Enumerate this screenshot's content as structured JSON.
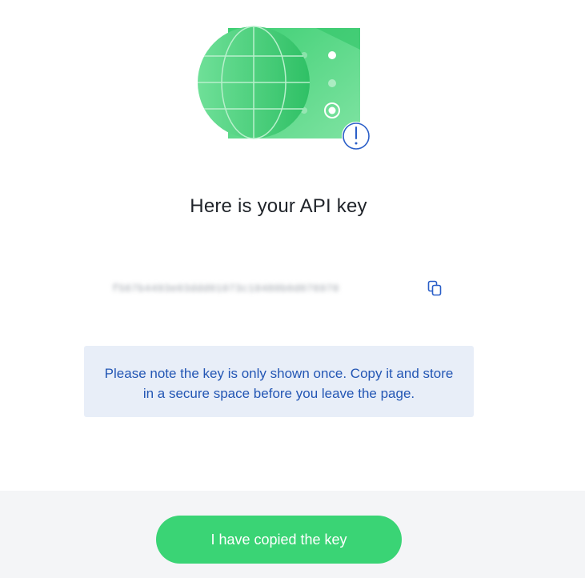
{
  "dialog": {
    "title": "Here is your API key",
    "api_key": "f567b4493e03ddd01073c18480b0d076970",
    "notice": "Please note the key is only shown once. Copy it and store in a secure space before you leave the page.",
    "confirm_button": "I have copied the key"
  },
  "icons": {
    "illustration": "globe-key-illustration",
    "warning": "exclamation-icon",
    "copy": "copy-icon"
  },
  "colors": {
    "brand_green": "#3ad475",
    "notice_background": "#e8eef8",
    "notice_text": "#2356b4",
    "accent_blue": "#2b5fc8"
  }
}
